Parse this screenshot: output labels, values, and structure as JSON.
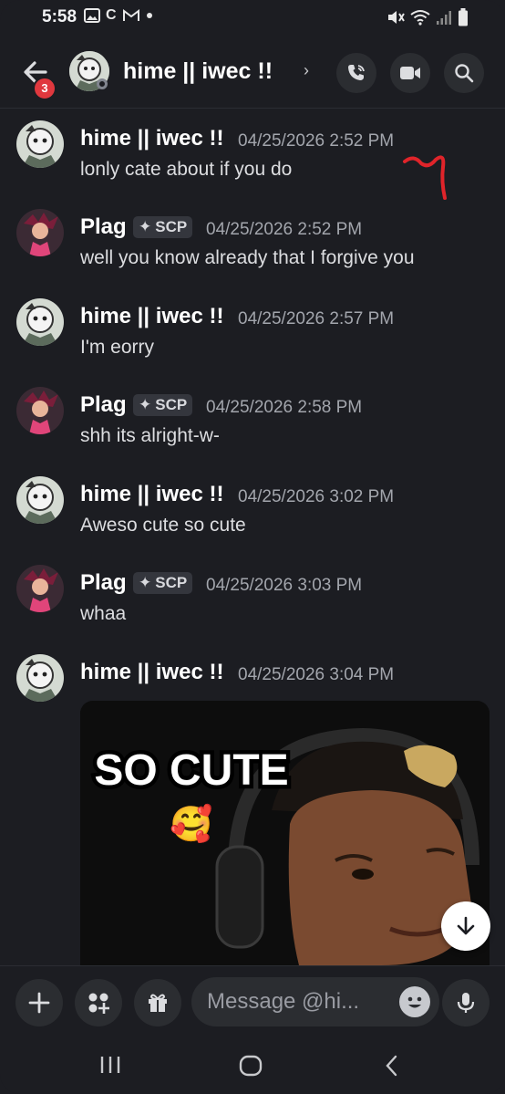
{
  "status_bar": {
    "time": "5:58",
    "indicators": [
      "image-icon",
      "C",
      "gmail-icon",
      "dot"
    ],
    "c_letter": "C",
    "right_icons": [
      "mute-icon",
      "wifi-icon",
      "signal-icon",
      "battery-icon"
    ]
  },
  "header": {
    "back_badge": "3",
    "title": "hime || iwec !!",
    "chevron": "›",
    "actions": [
      "call-icon",
      "video-icon",
      "search-icon"
    ]
  },
  "messages": [
    {
      "author": "hime || iwec !!",
      "tag": "",
      "timestamp": "04/25/2026 2:52 PM",
      "text": "lonly cate about if you do"
    },
    {
      "author": "Plag",
      "tag": "SCP",
      "timestamp": "04/25/2026 2:52 PM",
      "text": "well you know already that I forgive you"
    },
    {
      "author": "hime || iwec !!",
      "tag": "",
      "timestamp": "04/25/2026 2:57 PM",
      "text": "I'm eorry"
    },
    {
      "author": "Plag",
      "tag": "SCP",
      "timestamp": "04/25/2026 2:58 PM",
      "text": "shh its alright-w-"
    },
    {
      "author": "hime || iwec !!",
      "tag": "",
      "timestamp": "04/25/2026 3:02 PM",
      "text": "Aweso cute so cute"
    },
    {
      "author": "Plag",
      "tag": "SCP",
      "timestamp": "04/25/2026 3:03 PM",
      "text": "whaa"
    },
    {
      "author": "hime || iwec !!",
      "tag": "",
      "timestamp": "04/25/2026 3:04 PM",
      "text": ""
    }
  ],
  "gif": {
    "caption": "SO CUTE",
    "emoji": "🥰"
  },
  "composer": {
    "placeholder": "Message @hi..."
  },
  "colors": {
    "background": "#1c1d22",
    "button": "#2b2d31",
    "badge": "#e0383e",
    "timestamp": "#a3a6ad",
    "annotation": "#e0242a"
  }
}
